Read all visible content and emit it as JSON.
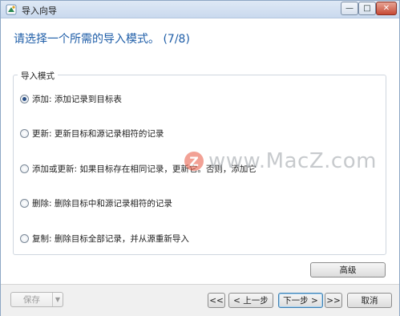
{
  "window": {
    "title": "导入向导",
    "minimize_glyph": "—",
    "maximize_glyph": "□",
    "close_glyph": "✕"
  },
  "header": {
    "step_title": "请选择一个所需的导入模式。 (7/8)"
  },
  "import_mode": {
    "legend": "导入模式",
    "options": [
      {
        "label": "添加: 添加记录到目标表",
        "selected": true
      },
      {
        "label": "更新: 更新目标和源记录相符的记录",
        "selected": false
      },
      {
        "label": "添加或更新: 如果目标存在相同记录，更新它。否则，添加它",
        "selected": false
      },
      {
        "label": "删除: 删除目标中和源记录相符的记录",
        "selected": false
      },
      {
        "label": "复制: 删除目标全部记录，并从源重新导入",
        "selected": false
      }
    ]
  },
  "buttons": {
    "advanced": "高级",
    "save": "保存",
    "save_dropdown_glyph": "▼",
    "first": "<<",
    "prev": "< 上一步",
    "next": "下一步 >",
    "last": ">>",
    "cancel": "取消"
  },
  "watermark": {
    "logo_letter": "Z",
    "text": "www.MacZ.com"
  },
  "colors": {
    "title_blue": "#1f5ea8",
    "watermark_red": "#e8563f"
  },
  "icons": {
    "app": "wizard-icon"
  }
}
